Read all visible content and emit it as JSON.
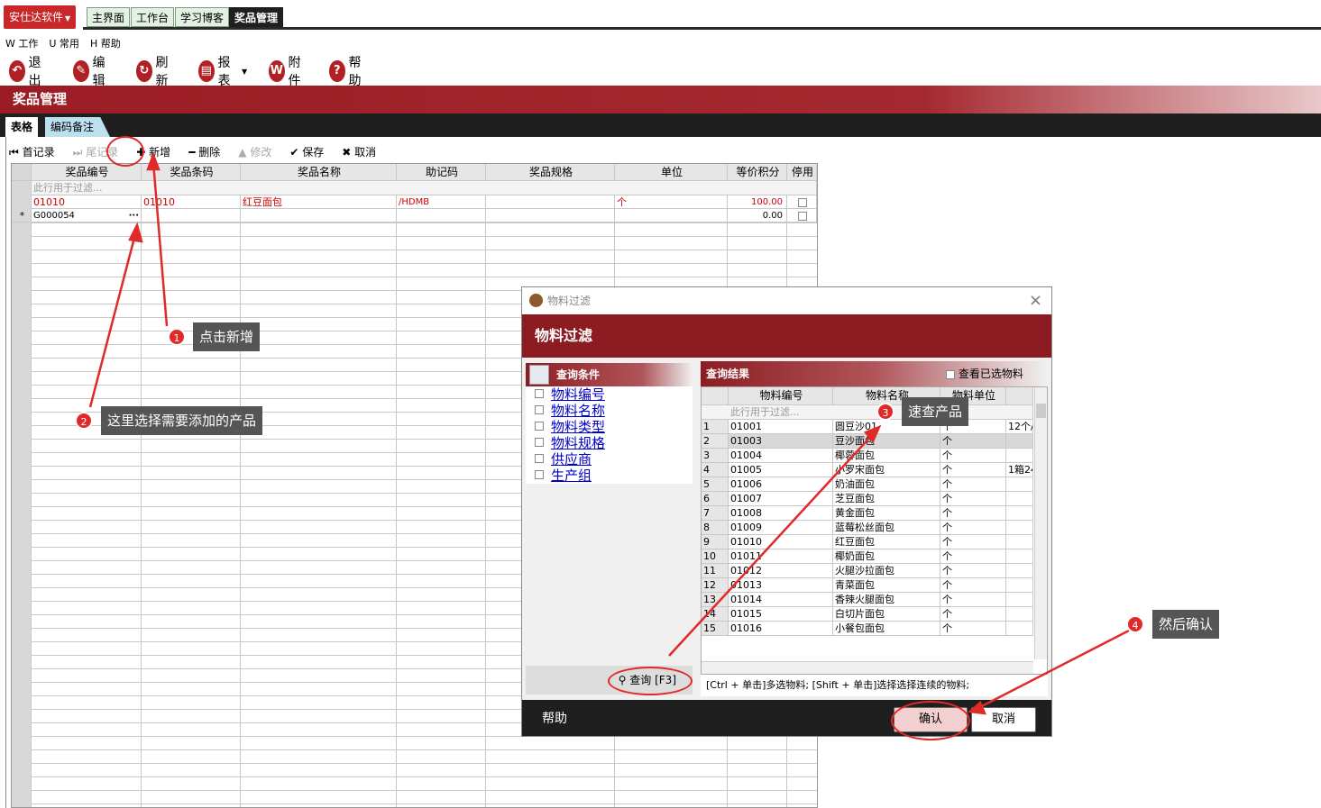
{
  "app": {
    "menu_label": "安仕达软件"
  },
  "top_tabs": [
    "主界面",
    "工作台",
    "学习博客",
    "奖品管理"
  ],
  "menubar": [
    "W 工作",
    "U 常用",
    "H 帮助"
  ],
  "toolbar": {
    "exit": "退出",
    "edit": "编辑",
    "refresh": "刷新",
    "report": "报表",
    "attach": "附件",
    "help": "帮助"
  },
  "page_title": "奖品管理",
  "sub_tabs": [
    "表格",
    "编码备注"
  ],
  "grid_toolbar": {
    "first": "首记录",
    "last": "尾记录",
    "add": "新增",
    "delete": "删除",
    "modify": "修改",
    "save": "保存",
    "cancel": "取消"
  },
  "grid": {
    "columns": [
      "奖品编号",
      "奖品条码",
      "奖品名称",
      "助记码",
      "奖品规格",
      "单位",
      "等价积分",
      "停用"
    ],
    "filter_row": "此行用于过滤...",
    "rows": [
      {
        "code": "01010",
        "barcode": "01010",
        "name": "红豆面包",
        "mnemonic": "/HDMB",
        "spec": "",
        "unit": "个",
        "points": "100.00"
      },
      {
        "code": "G000054",
        "barcode": "",
        "name": "",
        "mnemonic": "",
        "spec": "",
        "unit": "",
        "points": "0.00"
      }
    ],
    "new_row_marker": "*",
    "ellipsis": "···"
  },
  "dialog": {
    "window_title": "物料过滤",
    "banner": "物料过滤",
    "cond_title": "查询条件",
    "conditions": [
      "物料编号",
      "物料名称",
      "物料类型",
      "物料规格",
      "供应商",
      "生产组"
    ],
    "query_button": "查询 [F3]",
    "result_title": "查询结果",
    "show_selected": "查看已选物料",
    "columns": [
      "物料编号",
      "物料名称",
      "物料单位"
    ],
    "filter_row": "此行用于过滤...",
    "rows": [
      {
        "n": "1",
        "code": "01001",
        "name": "圆豆沙01",
        "unit": "个",
        "extra": "12个/"
      },
      {
        "n": "2",
        "code": "01003",
        "name": "豆沙面包",
        "unit": "个",
        "extra": ""
      },
      {
        "n": "3",
        "code": "01004",
        "name": "椰蓉面包",
        "unit": "个",
        "extra": ""
      },
      {
        "n": "4",
        "code": "01005",
        "name": "小罗宋面包",
        "unit": "个",
        "extra": "1箱24"
      },
      {
        "n": "5",
        "code": "01006",
        "name": "奶油面包",
        "unit": "个",
        "extra": ""
      },
      {
        "n": "6",
        "code": "01007",
        "name": "芝豆面包",
        "unit": "个",
        "extra": ""
      },
      {
        "n": "7",
        "code": "01008",
        "name": "黄金面包",
        "unit": "个",
        "extra": ""
      },
      {
        "n": "8",
        "code": "01009",
        "name": "蓝莓松丝面包",
        "unit": "个",
        "extra": ""
      },
      {
        "n": "9",
        "code": "01010",
        "name": "红豆面包",
        "unit": "个",
        "extra": ""
      },
      {
        "n": "10",
        "code": "01011",
        "name": "椰奶面包",
        "unit": "个",
        "extra": ""
      },
      {
        "n": "11",
        "code": "01012",
        "name": "火腿沙拉面包",
        "unit": "个",
        "extra": ""
      },
      {
        "n": "12",
        "code": "01013",
        "name": "青菜面包",
        "unit": "个",
        "extra": ""
      },
      {
        "n": "13",
        "code": "01014",
        "name": "香辣火腿面包",
        "unit": "个",
        "extra": ""
      },
      {
        "n": "14",
        "code": "01015",
        "name": "白切片面包",
        "unit": "个",
        "extra": ""
      },
      {
        "n": "15",
        "code": "01016",
        "name": "小餐包面包",
        "unit": "个",
        "extra": ""
      }
    ],
    "hint": "[Ctrl + 单击]多选物料; [Shift + 单击]选择选择连续的物料;",
    "help": "帮助",
    "ok": "确认",
    "cancel": "取消"
  },
  "callouts": [
    {
      "num": "1",
      "text": "点击新增"
    },
    {
      "num": "2",
      "text": "这里选择需要添加的产品"
    },
    {
      "num": "3",
      "text": "速查产品"
    },
    {
      "num": "4",
      "text": "然后确认"
    }
  ]
}
